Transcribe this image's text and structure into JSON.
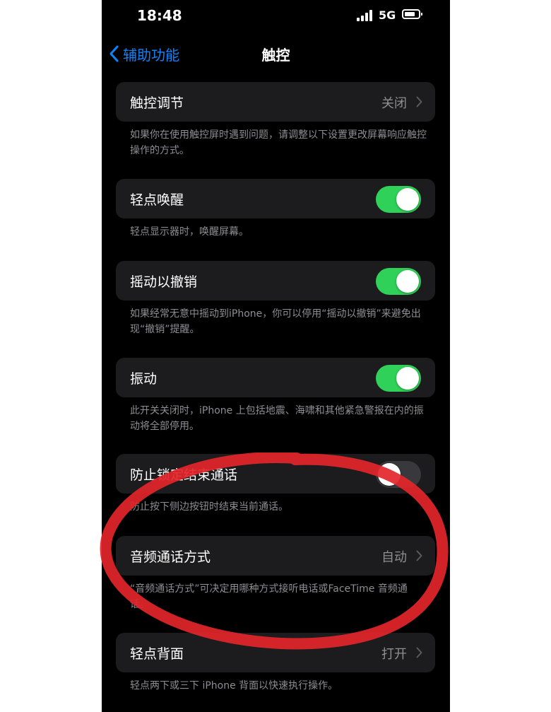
{
  "status_bar": {
    "time": "18:48",
    "network": "5G",
    "battery_level": 0.75
  },
  "nav": {
    "back_label": "辅助功能",
    "title": "触控",
    "accent": "#0a84ff"
  },
  "settings": {
    "touch_adjust": {
      "label": "触控调节",
      "value": "关闭",
      "footnote": "如果你在使用触控屏时遇到问题，请调整以下设置更改屏幕响应触控操作的方式。"
    },
    "tap_to_wake": {
      "label": "轻点唤醒",
      "enabled": true,
      "footnote": "轻点显示器时，唤醒屏幕。"
    },
    "shake_to_undo": {
      "label": "摇动以撤销",
      "enabled": true,
      "footnote": "如果经常无意中摇动到iPhone，你可以停用“摇动以撤销”来避免出现“撤销”提醒。"
    },
    "vibration": {
      "label": "振动",
      "enabled": true,
      "footnote": "此开关关闭时，iPhone 上包括地震、海啸和其他紧急警报在内的振动将全部停用。"
    },
    "prevent_lock_end_call": {
      "label": "防止锁定结束通话",
      "enabled": false,
      "footnote": "防止按下侧边按钮时结束当前通话。"
    },
    "call_audio_routing": {
      "label": "音频通话方式",
      "value": "自动",
      "footnote": "“音频通话方式”可决定用哪种方式接听电话或FaceTime 音频通话。"
    },
    "back_tap": {
      "label": "轻点背面",
      "value": "打开",
      "footnote": "轻点两下或三下 iPhone 背面以快速执行操作。"
    }
  },
  "colors": {
    "toggle_on": "#30d158",
    "toggle_off": "#39393d",
    "cell_background": "#1c1c1e",
    "annotation_red": "#e3262a"
  },
  "icons": {
    "back": "chevron-left-icon",
    "disclosure": "chevron-right-icon",
    "signal": "cellular-signal-icon",
    "battery": "battery-icon"
  }
}
